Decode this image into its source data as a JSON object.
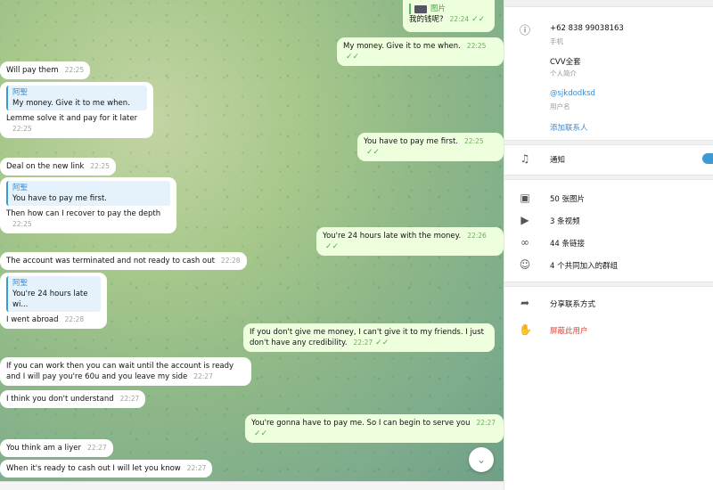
{
  "chat": {
    "out": [
      {
        "text": "我的钱呢?",
        "time": "22:24"
      },
      {
        "text": "My money. Give it to me when.",
        "time": "22:25"
      },
      {
        "text": "You have to pay me first.",
        "time": "22:25"
      },
      {
        "text": "You're 24 hours late with the money.",
        "time": "22:26"
      },
      {
        "text": "If you don't give me money, I can't give it to my friends. I just don't have any credibility.",
        "time": "22:27"
      },
      {
        "text": "You're gonna have to pay me. So I can begin to serve you",
        "time": "22:27"
      }
    ],
    "image_reply_label": "图片",
    "in": [
      {
        "text": "Will pay them",
        "time": "22:25"
      },
      {
        "reply_name": "阿聖",
        "reply_text": "My money. Give it to me when.",
        "text": "Lemme solve it and pay for it later",
        "time": "22:25"
      },
      {
        "text": "Deal on the new link",
        "time": "22:25"
      },
      {
        "reply_name": "阿聖",
        "reply_text": "You have to pay me first.",
        "text": "Then how can I recover to pay the depth",
        "time": "22:25"
      },
      {
        "text": "The account was terminated and not ready to cash out",
        "time": "22:28"
      },
      {
        "reply_name": "阿聖",
        "reply_text": "You're 24 hours late wi...",
        "text": "I went abroad",
        "time": "22:28"
      },
      {
        "text": "If you can work then you can wait until the account is ready and I will pay you're 60u and you leave my side",
        "time": "22:27"
      },
      {
        "text": "I think you don't understand",
        "time": "22:27"
      },
      {
        "text": "You think am a liyer",
        "time": "22:27"
      },
      {
        "text": "When it's ready to cash out I will let you know",
        "time": "22:27"
      }
    ]
  },
  "profile": {
    "phone": "+62 838 99038163",
    "phone_label": "手机",
    "bio": "CVV全套",
    "bio_label": "个人简介",
    "username": "@sjkdodksd",
    "username_label": "用户名",
    "add_contact": "添加联系人",
    "notifications": "通知",
    "photos": "50 张图片",
    "videos": "3 条视频",
    "links": "44 条链接",
    "groups": "4 个共同加入的群组",
    "share_contact": "分享联系方式",
    "block_user": "屏蔽此用户"
  },
  "colors": {
    "accent": "#3a9bd5",
    "danger": "#e0443a",
    "outgoing_bubble": "#eeffde"
  }
}
